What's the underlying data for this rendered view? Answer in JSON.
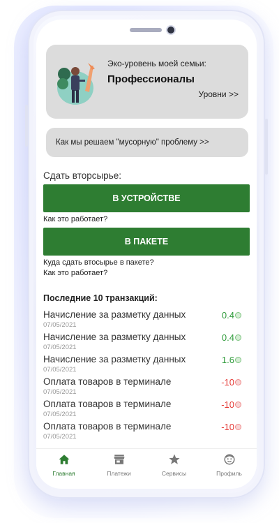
{
  "eco": {
    "label": "Эко-уровень моей семьи:",
    "level": "Профессионалы",
    "levels_link": "Уровни >>"
  },
  "garbage_link": "Как мы решаем \"мусорную\" проблему >>",
  "recycle": {
    "title": "Сдать вторсырье:",
    "device_button": "В УСТРОЙСТВЕ",
    "device_how": "Как это работает?",
    "package_button": "В ПАКЕТЕ",
    "package_where": "Куда сдать втосырье в пакете?",
    "package_how": "Как это работает?"
  },
  "transactions": {
    "title": "Последние 10 транзакций:",
    "items": [
      {
        "name": "Начисление за разметку данных",
        "date": "07/05/2021",
        "amount": "0.4",
        "type": "pos"
      },
      {
        "name": "Начисление за разметку данных",
        "date": "07/05/2021",
        "amount": "0.4",
        "type": "pos"
      },
      {
        "name": "Начисление за разметку данных",
        "date": "07/05/2021",
        "amount": "1.6",
        "type": "pos"
      },
      {
        "name": "Оплата товаров в терминале",
        "date": "07/05/2021",
        "amount": "-10",
        "type": "neg"
      },
      {
        "name": "Оплата товаров в терминале",
        "date": "07/05/2021",
        "amount": "-10",
        "type": "neg"
      },
      {
        "name": "Оплата товаров в терминале",
        "date": "07/05/2021",
        "amount": "-10",
        "type": "neg"
      }
    ]
  },
  "nav": {
    "items": [
      {
        "label": "Главная",
        "icon": "home-icon",
        "active": true
      },
      {
        "label": "Платежи",
        "icon": "store-icon",
        "active": false
      },
      {
        "label": "Сервисы",
        "icon": "star-icon",
        "active": false
      },
      {
        "label": "Профиль",
        "icon": "profile-icon",
        "active": false
      }
    ]
  },
  "colors": {
    "primary_green": "#2e7d32",
    "positive": "#2e9a3a",
    "negative": "#e53935",
    "card_bg": "#dcdcdc"
  }
}
